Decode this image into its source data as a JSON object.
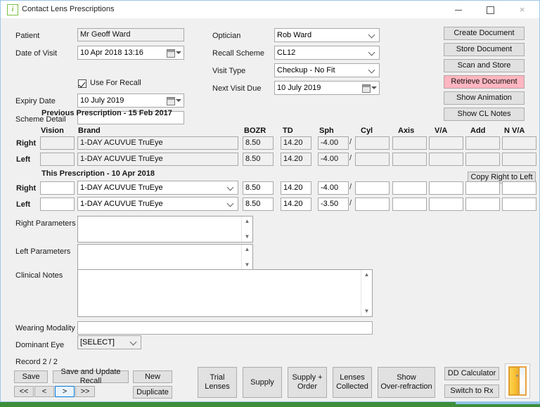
{
  "window": {
    "title": "Contact Lens Prescriptions",
    "icon": "info-icon",
    "minimize": "–",
    "maximize": "□",
    "close": "×"
  },
  "form": {
    "patient_label": "Patient",
    "patient_value": "Mr Geoff Ward",
    "date_of_visit_label": "Date of Visit",
    "date_of_visit_value": "10 Apr  2018 13:16",
    "use_for_recall_label": "Use For Recall",
    "use_for_recall_checked": true,
    "expiry_date_label": "Expiry Date",
    "expiry_date_value": "10      July      2019",
    "scheme_detail_label": "Scheme Detail",
    "scheme_detail_value": "",
    "optician_label": "Optician",
    "optician_value": "Rob Ward",
    "recall_scheme_label": "Recall Scheme",
    "recall_scheme_value": "CL12",
    "visit_type_label": "Visit Type",
    "visit_type_value": "Checkup - No Fit",
    "next_visit_due_label": "Next Visit Due",
    "next_visit_due_value": "10      July      2019"
  },
  "doc_buttons": [
    {
      "label": "Create Document",
      "style": "normal"
    },
    {
      "label": "Store Document",
      "style": "normal"
    },
    {
      "label": "Scan and Store",
      "style": "normal"
    },
    {
      "label": "Retrieve Document",
      "style": "pink"
    },
    {
      "label": "Show Animation",
      "style": "normal"
    },
    {
      "label": "Show CL Notes",
      "style": "normal"
    }
  ],
  "previous": {
    "heading": "Previous Prescription - 15 Feb 2017",
    "columns": [
      "Vision",
      "Brand",
      "BOZR",
      "TD",
      "Sph",
      "Cyl",
      "Axis",
      "V/A",
      "Add",
      "N V/A"
    ],
    "rows": [
      {
        "eye": "Right",
        "vision": "",
        "brand": "1-DAY ACUVUE TruEye",
        "bozr": "8.50",
        "td": "14.20",
        "sph": "-4.00",
        "cyl": "",
        "axis": "",
        "va": "",
        "add": "",
        "nva": ""
      },
      {
        "eye": "Left",
        "vision": "",
        "brand": "1-DAY ACUVUE TruEye",
        "bozr": "8.50",
        "td": "14.20",
        "sph": "-4.00",
        "cyl": "",
        "axis": "",
        "va": "",
        "add": "",
        "nva": ""
      }
    ]
  },
  "current": {
    "heading": "This Prescription - 10 Apr 2018",
    "copy_button": "Copy Right to Left",
    "rows": [
      {
        "eye": "Right",
        "vision": "",
        "brand": "1-DAY ACUVUE TruEye",
        "bozr": "8.50",
        "td": "14.20",
        "sph": "-4.00",
        "cyl": "",
        "axis": "",
        "va": "",
        "add": "",
        "nva": ""
      },
      {
        "eye": "Left",
        "vision": "",
        "brand": "1-DAY ACUVUE TruEye",
        "bozr": "8.50",
        "td": "14.20",
        "sph": "-3.50",
        "cyl": "",
        "axis": "",
        "va": "",
        "add": "",
        "nva": ""
      }
    ]
  },
  "notes": {
    "right_parameters_label": "Right Parameters",
    "right_parameters_value": "",
    "left_parameters_label": "Left Parameters",
    "left_parameters_value": "",
    "clinical_notes_label": "Clinical Notes",
    "clinical_notes_value": "",
    "wearing_modality_label": "Wearing Modality",
    "wearing_modality_value": "",
    "dominant_eye_label": "Dominant Eye",
    "dominant_eye_value": "[SELECT]"
  },
  "record": {
    "counter": "Record 2 / 2",
    "save": "Save",
    "save_update_recall": "Save and Update Recall",
    "new": "New",
    "duplicate": "Duplicate",
    "nav_first": "<<",
    "nav_prev": "<",
    "nav_next": ">",
    "nav_last": ">>"
  },
  "actions": {
    "trial_lenses": "Trial\nLenses",
    "supply": "Supply",
    "supply_order": "Supply +\nOrder",
    "lenses_collected": "Lenses\nCollected",
    "show_over_refraction": "Show\nOver-refraction",
    "dd_calculator": "DD Calculator",
    "switch_to_rx": "Switch to Rx",
    "exit": "exit-door-icon"
  },
  "colors": {
    "accent_pink": "#ffb6c1",
    "window_border": "#9cc8e8",
    "face": "#f0f0f0",
    "focus_blue": "#0078d7",
    "strip_green": "#3c8e3a"
  }
}
